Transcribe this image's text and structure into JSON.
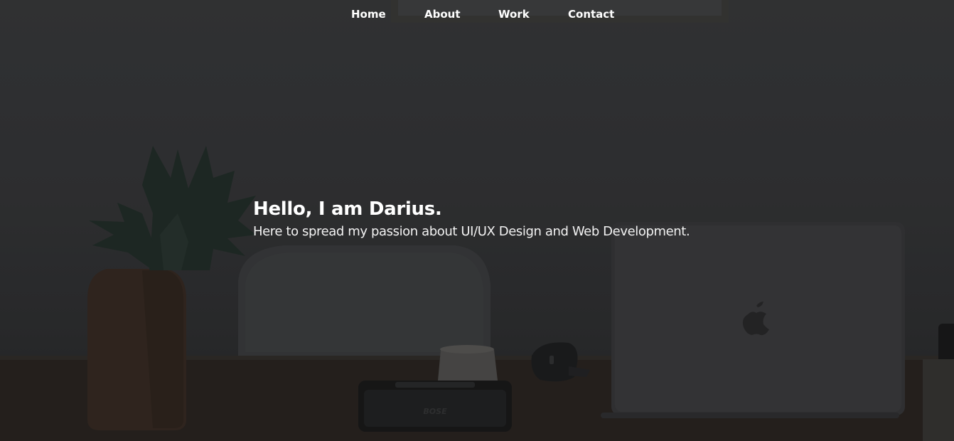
{
  "nav": {
    "items": [
      {
        "label": "Home"
      },
      {
        "label": "About"
      },
      {
        "label": "Work"
      },
      {
        "label": "Contact"
      }
    ]
  },
  "hero": {
    "headline": "Hello, I am Darius.",
    "tagline": "Here to spread my passion about UI/UX Design and Web Development.",
    "background_image": "dark-desk-workspace-photo",
    "speaker_brand_mark": "BOSE"
  },
  "colors": {
    "text": "#ffffff",
    "background": "#37383a",
    "desk": "#2b2622"
  }
}
